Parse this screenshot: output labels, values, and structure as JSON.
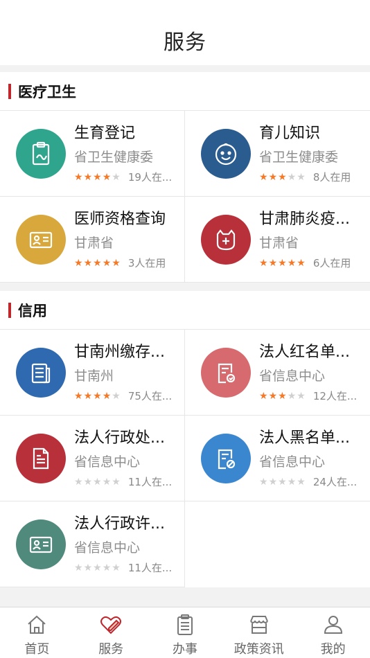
{
  "header": {
    "title": "服务"
  },
  "sections": [
    {
      "title": "医疗卫生",
      "items": [
        {
          "name": "生育登记",
          "dept": "省卫生健康委",
          "rating": 4,
          "users": "19人在...",
          "icon": "clipboard-icon",
          "color": "#2fa58e"
        },
        {
          "name": "育儿知识",
          "dept": "省卫生健康委",
          "rating": 3,
          "users": "8人在用",
          "icon": "baby-face-icon",
          "color": "#2a5c8f"
        },
        {
          "name": "医师资格查询",
          "dept": "甘肃省",
          "rating": 5,
          "users": "3人在用",
          "icon": "id-card-icon",
          "color": "#d9a83c"
        },
        {
          "name": "甘肃肺炎疫...",
          "dept": "甘肃省",
          "rating": 5,
          "users": "6人在用",
          "icon": "medical-bag-icon",
          "color": "#b8303a"
        }
      ]
    },
    {
      "title": "信用",
      "items": [
        {
          "name": "甘南州缴存...",
          "dept": "甘南州",
          "rating": 4,
          "users": "75人在...",
          "icon": "newspaper-icon",
          "color": "#2f69b0"
        },
        {
          "name": "法人红名单...",
          "dept": "省信息中心",
          "rating": 3,
          "users": "12人在...",
          "icon": "document-check-icon",
          "color": "#d66a6e"
        },
        {
          "name": "法人行政处...",
          "dept": "省信息中心",
          "rating": 0,
          "users": "11人在...",
          "icon": "penalty-document-icon",
          "color": "#b8303a"
        },
        {
          "name": "法人黑名单...",
          "dept": "省信息中心",
          "rating": 0,
          "users": "24人在...",
          "icon": "document-ban-icon",
          "color": "#3b87cf"
        },
        {
          "name": "法人行政许...",
          "dept": "省信息中心",
          "rating": 0,
          "users": "11人在...",
          "icon": "license-card-icon",
          "color": "#4f8a7c"
        }
      ]
    }
  ],
  "tabbar": [
    {
      "label": "首页",
      "icon": "home-icon",
      "active": false
    },
    {
      "label": "服务",
      "icon": "heart-pen-icon",
      "active": true
    },
    {
      "label": "办事",
      "icon": "clipboard-list-icon",
      "active": false
    },
    {
      "label": "政策资讯",
      "icon": "storefront-icon",
      "active": false
    },
    {
      "label": "我的",
      "icon": "user-icon",
      "active": false
    }
  ]
}
